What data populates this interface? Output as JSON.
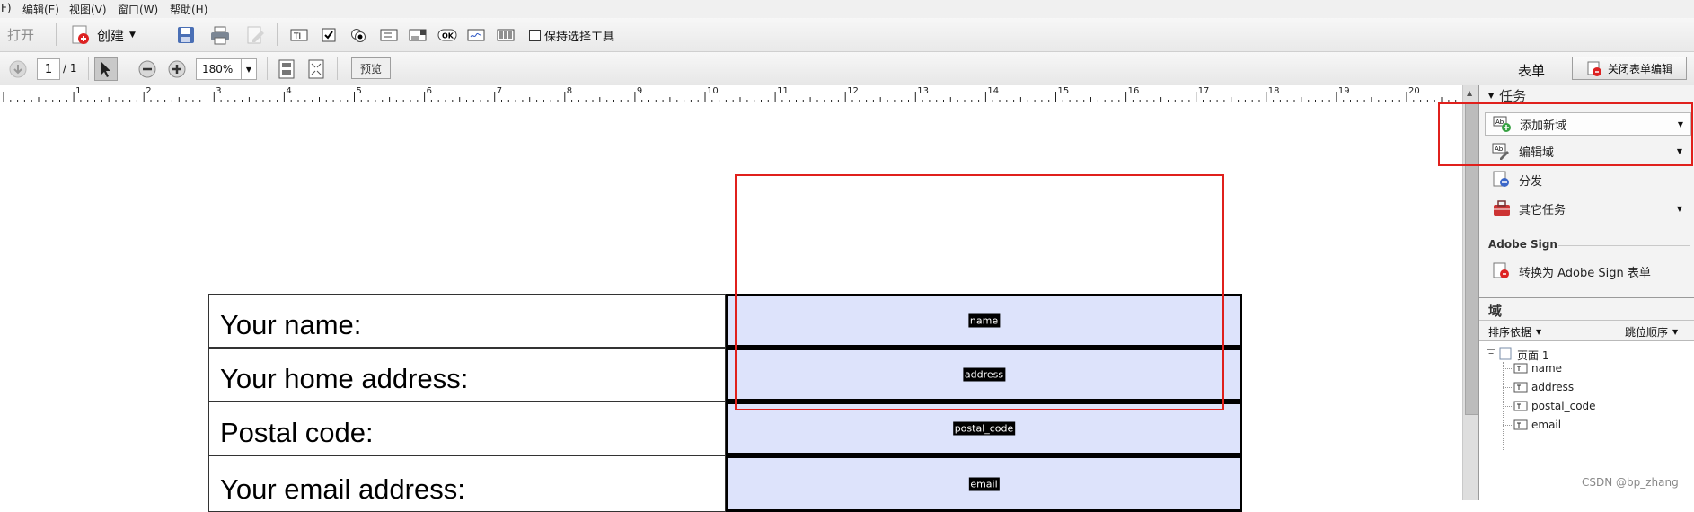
{
  "menu": {
    "items": [
      "F)",
      "编辑(E)",
      "视图(V)",
      "窗口(W)",
      "帮助(H)"
    ]
  },
  "toolbar1": {
    "open_label": "打开",
    "create_label": "创建",
    "keep_tool_label": "保持选择工具",
    "ok_icon_text": "OK"
  },
  "toolbar2": {
    "page_current": "1",
    "page_total": "/ 1",
    "zoom": "180%",
    "preview_label": "预览",
    "form_label": "表单",
    "close_form_label": "关闭表单编辑"
  },
  "ruler": {
    "numbers": [
      "1",
      "2",
      "3",
      "4",
      "5",
      "6",
      "7",
      "8",
      "9",
      "10",
      "11",
      "12",
      "13",
      "14",
      "15",
      "16",
      "17",
      "18",
      "19",
      "20"
    ]
  },
  "form": {
    "rows": [
      {
        "label": "Your name:",
        "field": "name"
      },
      {
        "label": "Your home address:",
        "field": "address"
      },
      {
        "label": "Postal code:",
        "field": "postal_code"
      },
      {
        "label": "Your email address:",
        "field": "email"
      }
    ]
  },
  "panel": {
    "tasks_title": "任务",
    "add_field": "添加新域",
    "edit_field": "编辑域",
    "distribute": "分发",
    "other_tasks": "其它任务",
    "adobe_sign_title": "Adobe Sign",
    "convert_adobe_sign": "转换为 Adobe Sign 表单",
    "fields_title": "域",
    "sort_by": "排序依据",
    "tab_order": "跳位顺序",
    "page_node": "页面 1",
    "tree_items": [
      "name",
      "address",
      "postal_code",
      "email"
    ]
  },
  "watermark": "CSDN @bp_zhang",
  "colors": {
    "field_fill": "#dde3fb",
    "highlight_red": "#e0201c"
  }
}
